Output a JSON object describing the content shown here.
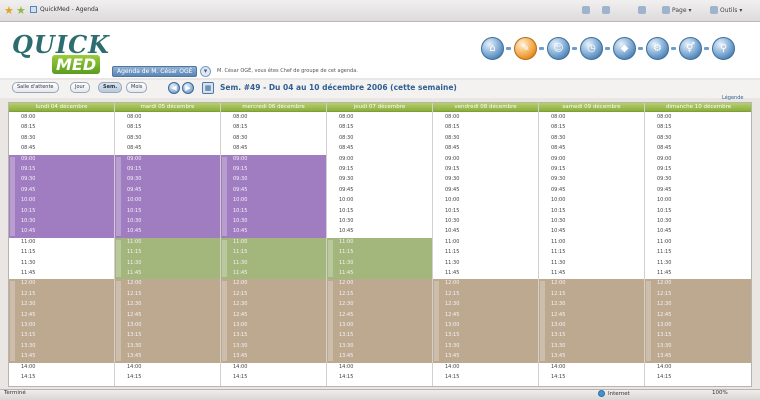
{
  "browser": {
    "tab_title": "QuickMed - Agenda",
    "home_label": "",
    "feed_label": "",
    "page_label": "Page",
    "tools_label": "Outils"
  },
  "app": {
    "logo_top": "QUICK",
    "logo_bottom": "MED",
    "agenda_select": "Agenda de M. César OGÉ",
    "group_note": "M. César OGÉ, vous êtes Chef de groupe de cet agenda.",
    "nav_icons": [
      "home-icon",
      "agenda-icon",
      "users-icon",
      "clock-icon",
      "car-icon",
      "settings-icon",
      "gender-icon",
      "search-icon"
    ]
  },
  "toolbar": {
    "waiting_room": "Salle d'attente",
    "day_view": "Jour",
    "week_view": "Sem.",
    "month_view": "Mois",
    "prev": "◀",
    "next": "▶",
    "calendar_icon": "calendar-icon",
    "week_title": "Sem. #49 - Du 04 au 10 décembre 2006 (cette semaine)",
    "legend": "Légende"
  },
  "days": [
    {
      "label": "lundi 04 décembre"
    },
    {
      "label": "mardi 05 décembre"
    },
    {
      "label": "mercredi 06 décembre"
    },
    {
      "label": "jeudi 07 décembre"
    },
    {
      "label": "vendredi 08 décembre"
    },
    {
      "label": "samedi 09 décembre"
    },
    {
      "label": "dimanche 10 décembre"
    }
  ],
  "slots": [
    "08:00",
    "08:15",
    "08:30",
    "08:45",
    "09:00",
    "09:15",
    "09:30",
    "09:45",
    "10:00",
    "10:15",
    "10:30",
    "10:45",
    "11:00",
    "11:15",
    "11:30",
    "11:45",
    "12:00",
    "12:15",
    "12:30",
    "12:45",
    "13:00",
    "13:15",
    "13:30",
    "13:45",
    "14:00",
    "14:15"
  ],
  "colors": {
    "purple": "#a07cc0",
    "green": "#a3b67c",
    "brown": "#bca98f",
    "header_green": "#8bae3e"
  },
  "status": {
    "left": "Terminé",
    "zone": "Internet",
    "zoom": "100%"
  }
}
